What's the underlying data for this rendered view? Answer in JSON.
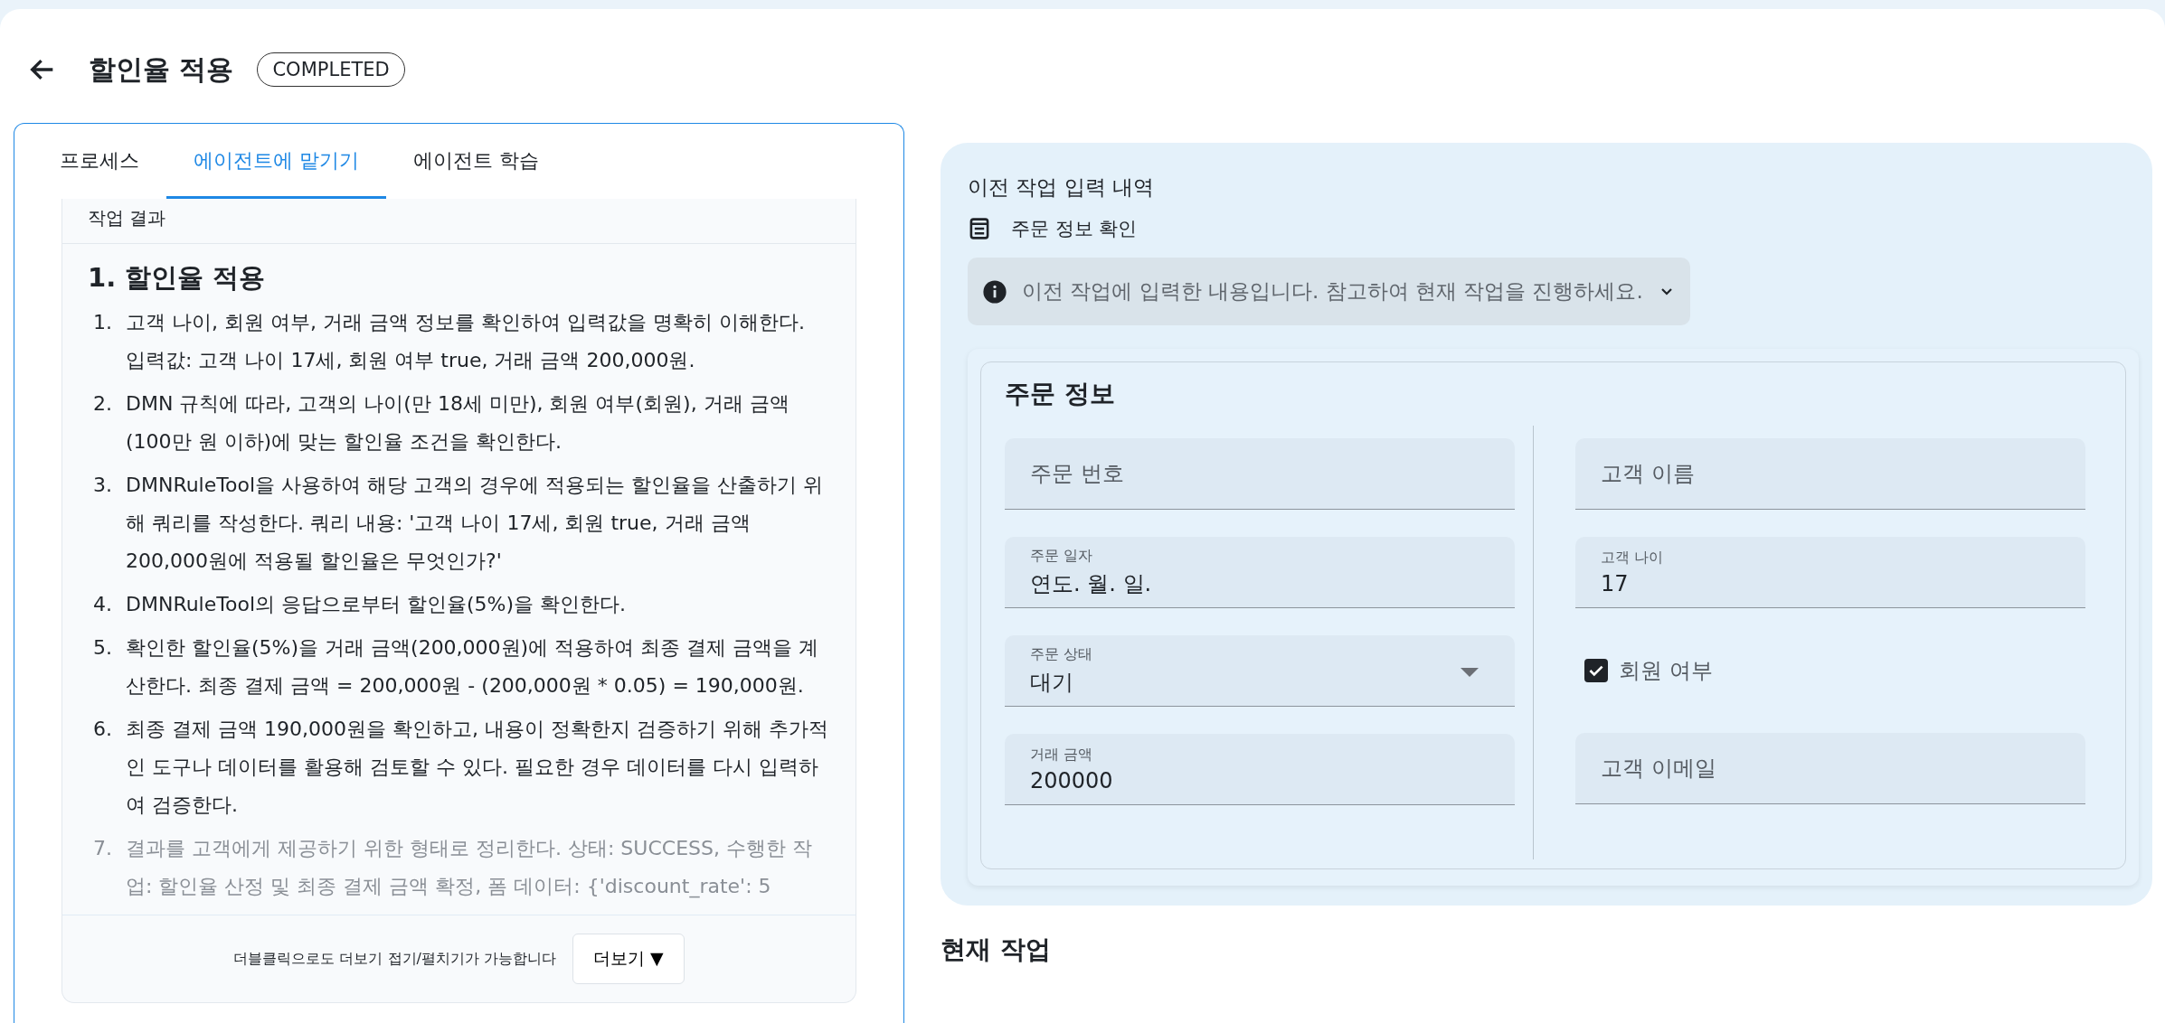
{
  "header": {
    "title": "할인율 적용",
    "status": "COMPLETED"
  },
  "tabs": [
    {
      "label": "프로세스",
      "selected": false
    },
    {
      "label": "에이전트에 맡기기",
      "selected": true
    },
    {
      "label": "에이전트 학습",
      "selected": false
    }
  ],
  "result": {
    "title": "작업 결과",
    "heading": "1. 할인율 적용",
    "steps": [
      {
        "marker": "1.",
        "text": "고객 나이, 회원 여부, 거래 금액 정보를 확인하여 입력값을 명확히 이해한다. 입력값: 고객 나이 17세, 회원 여부 true, 거래 금액 200,000원.",
        "faded": false
      },
      {
        "marker": "2.",
        "text": "DMN 규칙에 따라, 고객의 나이(만 18세 미만), 회원 여부(회원), 거래 금액 (100만 원 이하)에 맞는 할인율 조건을 확인한다.",
        "faded": false
      },
      {
        "marker": "3.",
        "text": "DMNRuleTool을 사용하여 해당 고객의 경우에 적용되는 할인율을 산출하기 위해 쿼리를 작성한다. 쿼리 내용: '고객 나이 17세, 회원 true, 거래 금액 200,000원에 적용될 할인율은 무엇인가?'",
        "faded": false
      },
      {
        "marker": "4.",
        "text": "DMNRuleTool의 응답으로부터 할인율(5%)을 확인한다.",
        "faded": false
      },
      {
        "marker": "5.",
        "text": "확인한 할인율(5%)을 거래 금액(200,000원)에 적용하여 최종 결제 금액을 계산한다. 최종 결제 금액 = 200,000원 - (200,000원 * 0.05) = 190,000원.",
        "faded": false
      },
      {
        "marker": "6.",
        "text": "최종 결제 금액 190,000원을 확인하고, 내용이 정확한지 검증하기 위해 추가적인 도구나 데이터를 활용해 검토할 수 있다. 필요한 경우 데이터를 다시 입력하여 검증한다.",
        "faded": false
      },
      {
        "marker": "7.",
        "text": "결과를 고객에게 제공하기 위한 형태로 정리한다. 상태: SUCCESS, 수행한 작업: 할인율 산정 및 최종 결제 금액 확정, 폼 데이터: {'discount_rate': 5",
        "faded": true
      }
    ],
    "hint": "더블클릭으로도 더보기 접기/펼치기가 가능합니다",
    "more_button": "더보기 ▼"
  },
  "previous": {
    "title": "이전 작업 입력 내역",
    "task": "주문 정보 확인",
    "notice": "이전 작업에 입력한 내용입니다. 참고하여 현재 작업을 진행하세요.",
    "form": {
      "title": "주문 정보",
      "columns": [
        [
          {
            "kind": "text",
            "label": "주문 번호"
          },
          {
            "kind": "text",
            "label": "주문 일자",
            "value": "연도. 월. 일."
          },
          {
            "kind": "select",
            "label": "주문 상태",
            "value": "대기"
          },
          {
            "kind": "text",
            "label": "거래 금액",
            "value": "200000"
          }
        ],
        [
          {
            "kind": "text",
            "label": "고객 이름"
          },
          {
            "kind": "text",
            "label": "고객 나이",
            "value": "17"
          },
          {
            "kind": "checkbox",
            "label": "회원 여부",
            "checked": true
          },
          {
            "kind": "text",
            "label": "고객 이메일"
          }
        ]
      ]
    }
  },
  "current": {
    "title": "현재 작업"
  }
}
